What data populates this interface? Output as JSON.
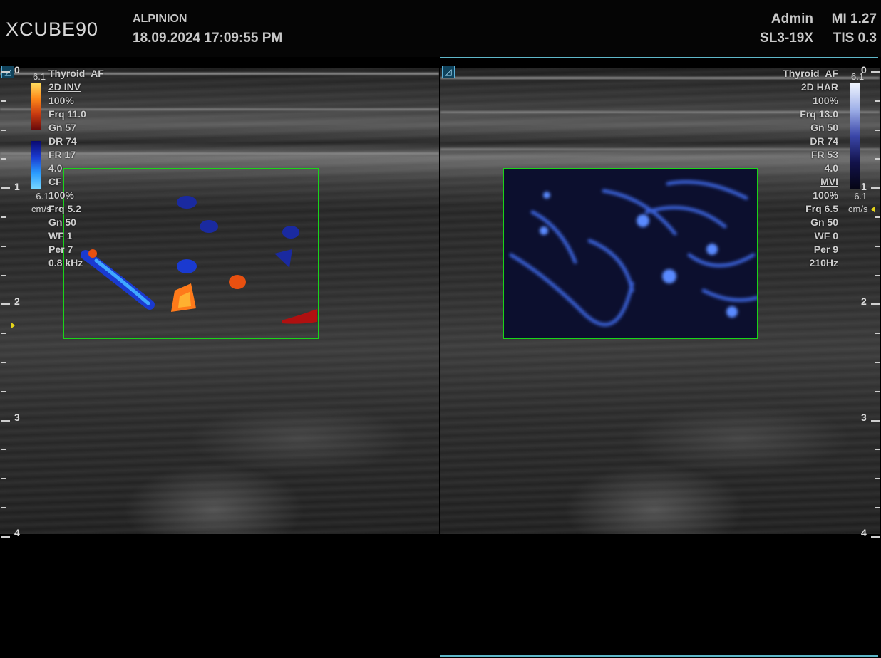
{
  "header": {
    "logo": "XCUBE90",
    "maker": "ALPINION",
    "datetime": "18.09.2024  17:09:55 PM",
    "user": "Admin",
    "mi": "MI 1.27",
    "probe": "SL3-19X",
    "tis": "TIS 0.3"
  },
  "left_pane": {
    "params": [
      "Thyroid_AF",
      "2D INV",
      "100%",
      "Frq 11.0",
      "Gn 57",
      "DR 74",
      "FR 17",
      "4.0",
      "CF",
      "100%",
      "Frq 5.2",
      "Gn 50",
      "WF 1",
      "Per 7",
      "0.8 kHz"
    ],
    "scale_max": "6.1",
    "scale_min": "-6.1",
    "scale_unit": "cm/s",
    "icon": "◿"
  },
  "right_pane": {
    "params": [
      "Thyroid_AF",
      "2D HAR",
      "100%",
      "Frq 13.0",
      "Gn 50",
      "DR 74",
      "FR 53",
      "4.0",
      "MVI",
      "100%",
      "Frq 6.5",
      "Gn 50",
      "WF 0",
      "Per 9",
      "210Hz"
    ],
    "scale_max": "6.1",
    "scale_mid": "1",
    "scale_min": "-6.1",
    "scale_unit": "cm/s",
    "icon": "◿"
  },
  "depth_left": [
    "0",
    "1",
    "2",
    "3",
    "4"
  ],
  "depth_right": [
    "0",
    "1",
    "2",
    "3",
    "4"
  ],
  "colors": {
    "roi_border": "#19d419",
    "active_frame": "#5fb7c9",
    "focus_marker": "#e4d41a"
  }
}
